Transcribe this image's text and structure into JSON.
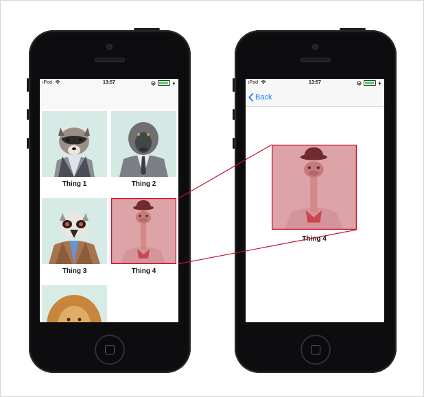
{
  "colors": {
    "highlight": "#c8102e",
    "overlay": "rgba(205,60,70,0.42)",
    "accent": "#1a7cf5"
  },
  "left_phone": {
    "status": {
      "carrier": "iPod",
      "time": "13:57"
    },
    "grid": [
      {
        "label": "Thing 1",
        "animal": "raccoon"
      },
      {
        "label": "Thing 2",
        "animal": "baboon"
      },
      {
        "label": "Thing 3",
        "animal": "lemur"
      },
      {
        "label": "Thing 4",
        "animal": "ostrich",
        "selected": true
      },
      {
        "label": "",
        "animal": "lion"
      }
    ]
  },
  "right_phone": {
    "status": {
      "carrier": "iPod",
      "time": "13:57"
    },
    "nav": {
      "back_label": "Back"
    },
    "detail": {
      "label": "Thing 4",
      "animal": "ostrich"
    }
  }
}
